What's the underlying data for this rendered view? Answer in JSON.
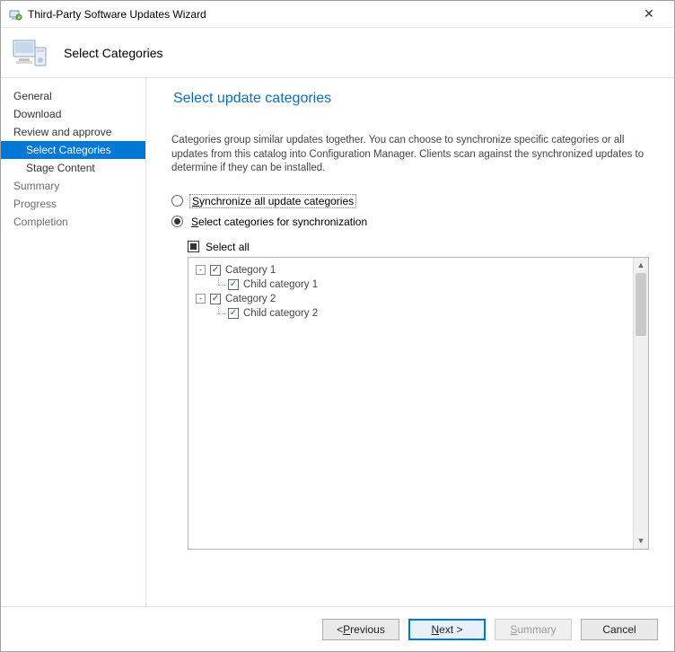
{
  "window": {
    "title": "Third-Party Software Updates Wizard",
    "close_glyph": "✕"
  },
  "header": {
    "title": "Select Categories"
  },
  "nav": {
    "items": [
      {
        "label": "General",
        "selected": false,
        "sub": false,
        "dim": false
      },
      {
        "label": "Download",
        "selected": false,
        "sub": false,
        "dim": false
      },
      {
        "label": "Review and approve",
        "selected": false,
        "sub": false,
        "dim": false
      },
      {
        "label": "Select Categories",
        "selected": true,
        "sub": true,
        "dim": false
      },
      {
        "label": "Stage Content",
        "selected": false,
        "sub": true,
        "dim": false
      },
      {
        "label": "Summary",
        "selected": false,
        "sub": false,
        "dim": true
      },
      {
        "label": "Progress",
        "selected": false,
        "sub": false,
        "dim": true
      },
      {
        "label": "Completion",
        "selected": false,
        "sub": false,
        "dim": true
      }
    ]
  },
  "page": {
    "title": "Select update categories",
    "description": "Categories group similar updates together. You can choose to synchronize specific categories or all updates from this catalog into Configuration Manager. Clients scan against the synchronized updates to determine if they can be installed.",
    "radio_all_prefix": "S",
    "radio_all_rest": "ynchronize all update categories",
    "radio_select_prefix": "S",
    "radio_select_rest": "elect categories for synchronization",
    "select_all_prefix": "S",
    "select_all_rest": "elect all",
    "selected_option": "select"
  },
  "tree": [
    {
      "level": 0,
      "expander": "-",
      "checked": true,
      "label": "Category 1"
    },
    {
      "level": 1,
      "expander": "",
      "checked": true,
      "label": "Child category 1"
    },
    {
      "level": 0,
      "expander": "-",
      "checked": true,
      "label": "Category 2"
    },
    {
      "level": 1,
      "expander": "",
      "checked": true,
      "label": "Child category 2"
    }
  ],
  "footer": {
    "previous_prefix": "< ",
    "previous_ul": "P",
    "previous_rest": "revious",
    "next_ul": "N",
    "next_rest": "ext >",
    "summary_ul": "S",
    "summary_rest": "ummary",
    "cancel": "Cancel"
  }
}
